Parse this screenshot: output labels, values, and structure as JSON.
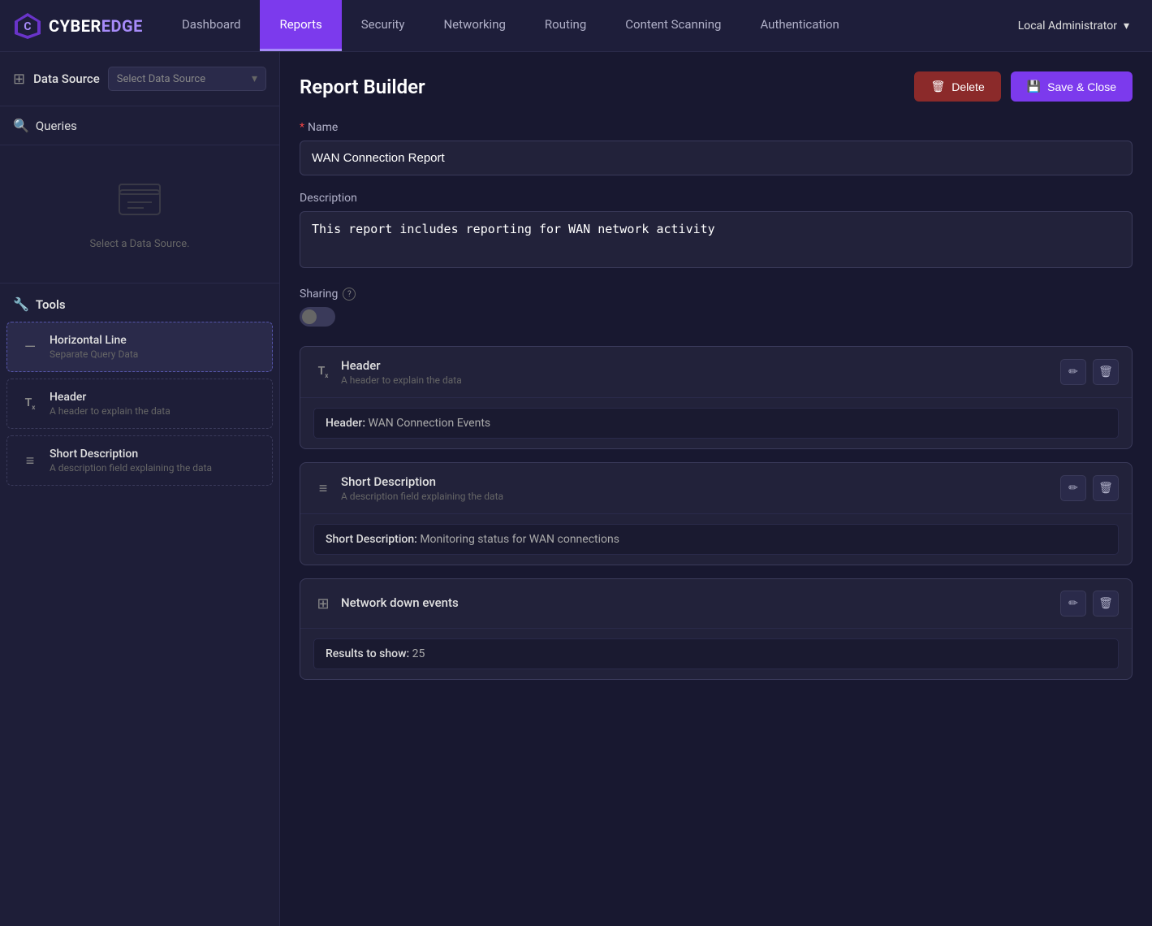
{
  "app": {
    "logo_cyber": "CYBER",
    "logo_edge": "EDGE"
  },
  "nav": {
    "items": [
      {
        "id": "dashboard",
        "label": "Dashboard",
        "active": false
      },
      {
        "id": "reports",
        "label": "Reports",
        "active": true
      },
      {
        "id": "security",
        "label": "Security",
        "active": false
      },
      {
        "id": "networking",
        "label": "Networking",
        "active": false
      },
      {
        "id": "routing",
        "label": "Routing",
        "active": false
      },
      {
        "id": "content-scanning",
        "label": "Content Scanning",
        "active": false
      },
      {
        "id": "authentication",
        "label": "Authentication",
        "active": false
      }
    ],
    "user": "Local Administrator"
  },
  "sidebar": {
    "datasource_label": "Data Source",
    "datasource_placeholder": "Select Data Source",
    "queries_label": "Queries",
    "empty_text": "Select a Data Source.",
    "tools_label": "Tools",
    "tools": [
      {
        "id": "horizontal-line",
        "icon": "—",
        "title": "Horizontal Line",
        "description": "Separate Query Data",
        "selected": true
      },
      {
        "id": "header",
        "icon": "Tₓ",
        "title": "Header",
        "description": "A header to explain the data",
        "selected": false
      },
      {
        "id": "short-description",
        "icon": "≡",
        "title": "Short Description",
        "description": "A description field explaining the data",
        "selected": false
      }
    ]
  },
  "report_builder": {
    "title": "Report Builder",
    "delete_label": "Delete",
    "save_label": "Save & Close",
    "name_label": "Name",
    "name_required": true,
    "name_value": "WAN Connection Report",
    "description_label": "Description",
    "description_value": "This report includes reporting for WAN network activity",
    "sharing_label": "Sharing",
    "sharing_enabled": false,
    "blocks": [
      {
        "id": "header-block",
        "icon": "Tₓ",
        "title": "Header",
        "subtitle": "A header to explain the data",
        "field_label": "Header:",
        "field_value": "WAN Connection Events"
      },
      {
        "id": "short-description-block",
        "icon": "≡",
        "title": "Short Description",
        "subtitle": "A description field explaining the data",
        "field_label": "Short Description:",
        "field_value": "Monitoring status for WAN connections"
      },
      {
        "id": "network-down-block",
        "icon": "⊞",
        "title": "Network down events",
        "subtitle": "",
        "field_label": "Results to show:",
        "field_value": "25"
      }
    ]
  }
}
